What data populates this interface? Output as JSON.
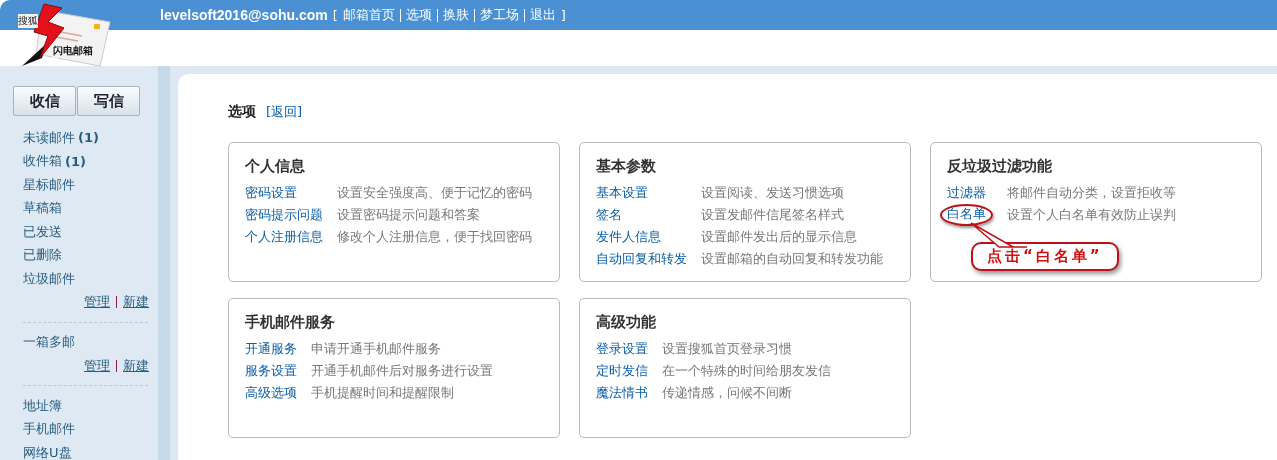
{
  "logo": {
    "brand": "搜狐",
    "product": "闪电邮箱"
  },
  "header": {
    "account": "levelsoft2016@sohu.com",
    "open_bracket": "[",
    "links": [
      "邮箱首页",
      "选项",
      "换肤",
      "梦工场",
      "退出"
    ],
    "close_bracket": "]"
  },
  "sidebar": {
    "buttons": [
      "收信",
      "写信"
    ],
    "groups": [
      {
        "items": [
          {
            "label": "未读邮件",
            "count": "(1)"
          },
          {
            "label": "收件箱",
            "count": "(1)"
          },
          {
            "label": "星标邮件"
          },
          {
            "label": "草稿箱"
          },
          {
            "label": "已发送"
          },
          {
            "label": "已删除"
          },
          {
            "label": "垃圾邮件"
          }
        ],
        "actions": [
          "管理",
          "新建"
        ]
      },
      {
        "items": [
          {
            "label": "一箱多邮"
          }
        ],
        "actions": [
          "管理",
          "新建"
        ]
      },
      {
        "items": [
          {
            "label": "地址簿"
          },
          {
            "label": "手机邮件"
          },
          {
            "label": "网络U盘"
          }
        ]
      }
    ]
  },
  "page": {
    "title": "选项",
    "back_link": "[返回]"
  },
  "cards": [
    {
      "title": "个人信息",
      "rows": [
        {
          "link": "密码设置",
          "desc": "设置安全强度高、便于记忆的密码"
        },
        {
          "link": "密码提示问题",
          "desc": "设置密码提示问题和答案"
        },
        {
          "link": "个人注册信息",
          "desc": "修改个人注册信息，便于找回密码"
        }
      ]
    },
    {
      "title": "基本参数",
      "rows": [
        {
          "link": "基本设置",
          "desc": "设置阅读、发送习惯选项"
        },
        {
          "link": "签名",
          "desc": "设置发邮件信尾签名样式"
        },
        {
          "link": "发件人信息",
          "desc": "设置邮件发出后的显示信息"
        },
        {
          "link": "自动回复和转发",
          "desc": "设置邮箱的自动回复和转发功能"
        }
      ]
    },
    {
      "title": "反垃圾过滤功能",
      "rows": [
        {
          "link": "过滤器",
          "desc": "将邮件自动分类，设置拒收等"
        },
        {
          "link": "白名单",
          "desc": "设置个人白名单有效防止误判",
          "highlighted": true
        }
      ],
      "callout": "点击“白名单”"
    },
    {
      "title": "手机邮件服务",
      "rows": [
        {
          "link": "开通服务",
          "desc": "申请开通手机邮件服务"
        },
        {
          "link": "服务设置",
          "desc": "开通手机邮件后对服务进行设置"
        },
        {
          "link": "高级选项",
          "desc": "手机提醒时间和提醒限制"
        }
      ]
    },
    {
      "title": "高级功能",
      "rows": [
        {
          "link": "登录设置",
          "desc": "设置搜狐首页登录习惯"
        },
        {
          "link": "定时发信",
          "desc": "在一个特殊的时间给朋友发信"
        },
        {
          "link": "魔法情书",
          "desc": "传递情感，问候不间断"
        }
      ]
    }
  ]
}
